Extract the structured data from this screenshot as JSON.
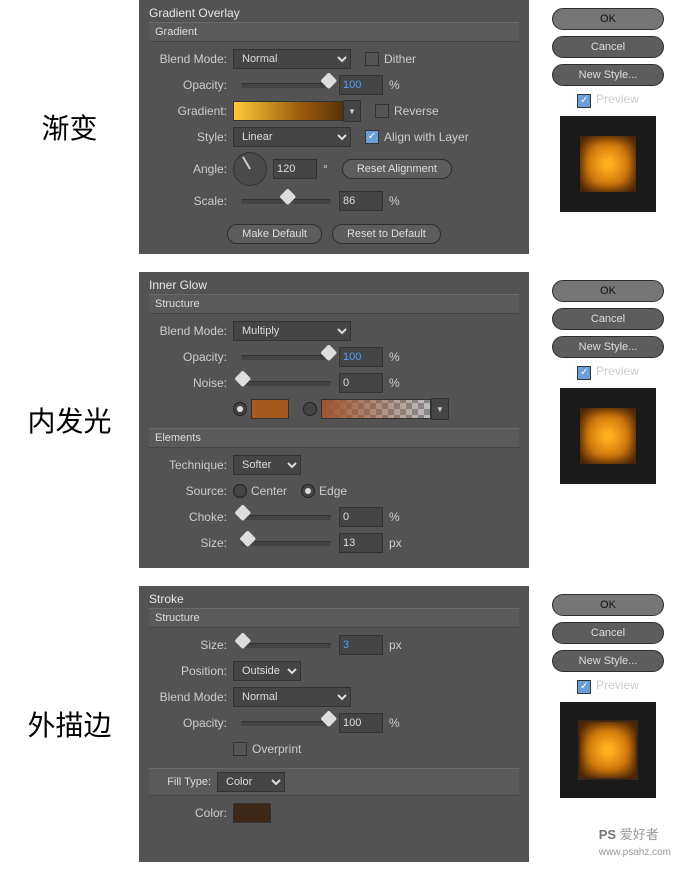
{
  "labels": {
    "gradient": "渐变",
    "innerGlow": "内发光",
    "stroke": "外描边"
  },
  "buttons": {
    "ok": "OK",
    "cancel": "Cancel",
    "newStyle": "New Style...",
    "preview": "Preview",
    "makeDefault": "Make Default",
    "resetDefault": "Reset to Default",
    "resetAlign": "Reset Alignment"
  },
  "grad": {
    "title": "Gradient Overlay",
    "sub": "Gradient",
    "blendModeL": "Blend Mode:",
    "blendMode": "Normal",
    "dither": "Dither",
    "opacityL": "Opacity:",
    "opacity": "100",
    "opU": "%",
    "gradientL": "Gradient:",
    "reverse": "Reverse",
    "styleL": "Style:",
    "style": "Linear",
    "align": "Align with Layer",
    "angleL": "Angle:",
    "angle": "120",
    "angU": "°",
    "scaleL": "Scale:",
    "scale": "86",
    "scU": "%"
  },
  "glow": {
    "title": "Inner Glow",
    "sub": "Structure",
    "blendModeL": "Blend Mode:",
    "blendMode": "Multiply",
    "opacityL": "Opacity:",
    "opacity": "100",
    "opU": "%",
    "noiseL": "Noise:",
    "noise": "0",
    "nU": "%",
    "elements": "Elements",
    "techL": "Technique:",
    "tech": "Softer",
    "sourceL": "Source:",
    "center": "Center",
    "edge": "Edge",
    "chokeL": "Choke:",
    "choke": "0",
    "cU": "%",
    "sizeL": "Size:",
    "size": "13",
    "sU": "px"
  },
  "stroke": {
    "title": "Stroke",
    "sub": "Structure",
    "sizeL": "Size:",
    "size": "3",
    "sU": "px",
    "posL": "Position:",
    "pos": "Outside",
    "blendModeL": "Blend Mode:",
    "blendMode": "Normal",
    "opacityL": "Opacity:",
    "opacity": "100",
    "opU": "%",
    "overprint": "Overprint",
    "fillTypeL": "Fill Type:",
    "fillType": "Color",
    "colorL": "Color:"
  },
  "watermark": {
    "brand": "PS",
    "site": "爱好者",
    "url": "www.psahz.com"
  }
}
